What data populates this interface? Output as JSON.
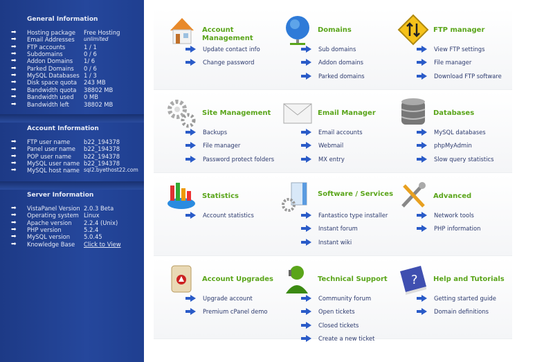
{
  "sidebar": {
    "sections": [
      {
        "title": "General Information",
        "rows": [
          {
            "label": "Hosting package",
            "value": "Free Hosting"
          },
          {
            "label": "Email Addresses",
            "value": "unlimited",
            "style": "italic"
          },
          {
            "label": "FTP accounts",
            "value": "1 / 1"
          },
          {
            "label": "Subdomains",
            "value": "0 / 6"
          },
          {
            "label": "Addon Domains",
            "value": "1/ 6"
          },
          {
            "label": "Parked Domains",
            "value": "0 / 6"
          },
          {
            "label": "MySQL Databases",
            "value": "1 / 3"
          },
          {
            "label": "Disk space quota",
            "value": "243 MB"
          },
          {
            "label": "Bandwidth quota",
            "value": "38802 MB"
          },
          {
            "label": "Bandwidth used",
            "value": "0 MB"
          },
          {
            "label": "Bandwidth left",
            "value": "38802 MB"
          }
        ]
      },
      {
        "title": "Account Information",
        "rows": [
          {
            "label": "FTP user name",
            "value": "b22_194378"
          },
          {
            "label": "Panel user name",
            "value": "b22_194378"
          },
          {
            "label": "POP user name",
            "value": "b22_194378"
          },
          {
            "label": "MySQL user name",
            "value": "b22_194378"
          },
          {
            "label": "MySQL host name",
            "value": "sql2.byethost22.com",
            "style": "small"
          }
        ]
      },
      {
        "title": "Server Information",
        "rows": [
          {
            "label": "VistaPanel Version",
            "value": "2.0.3 Beta"
          },
          {
            "label": "Operating system",
            "value": "Linux"
          },
          {
            "label": "Apache version",
            "value": "2.2.4 (Unix)"
          },
          {
            "label": "PHP version",
            "value": "5.2.4"
          },
          {
            "label": "MySQL version",
            "value": "5.0.45"
          },
          {
            "label": "Knowledge Base",
            "value": "Click to View",
            "style": "link"
          }
        ]
      }
    ]
  },
  "main": {
    "sections": [
      {
        "title": "Account Management",
        "icon": "house-icon",
        "links": [
          "Update contact info",
          "Change password"
        ]
      },
      {
        "title": "Domains",
        "icon": "globe-icon",
        "links": [
          "Sub domains",
          "Addon domains",
          "Parked domains"
        ]
      },
      {
        "title": "FTP manager",
        "icon": "ftp-sign-icon",
        "links": [
          "View FTP settings",
          "File manager",
          "Download FTP software"
        ]
      },
      {
        "title": "Site Management",
        "icon": "gears-icon",
        "links": [
          "Backups",
          "File manager",
          "Password protect folders"
        ]
      },
      {
        "title": "Email Manager",
        "icon": "envelope-icon",
        "links": [
          "Email accounts",
          "Webmail",
          "MX entry"
        ]
      },
      {
        "title": "Databases",
        "icon": "database-icon",
        "links": [
          "MySQL databases",
          "phpMyAdmin",
          "Slow query statistics"
        ]
      },
      {
        "title": "Statistics",
        "icon": "chart-icon",
        "links": [
          "Account statistics"
        ]
      },
      {
        "title": "Software / Services",
        "icon": "software-box-icon",
        "links": [
          "Fantastico type installer",
          "Instant forum",
          "Instant wiki"
        ]
      },
      {
        "title": "Advanced",
        "icon": "tools-icon",
        "links": [
          "Network tools",
          "PHP information"
        ]
      },
      {
        "title": "Account Upgrades",
        "icon": "upgrade-scroll-icon",
        "links": [
          "Upgrade account",
          "Premium cPanel demo"
        ]
      },
      {
        "title": "Technical Support",
        "icon": "support-person-icon",
        "links": [
          "Community forum",
          "Open tickets",
          "Closed tickets",
          "Create a new ticket"
        ]
      },
      {
        "title": "Help and Tutorials",
        "icon": "help-book-icon",
        "links": [
          "Getting started guide",
          "Domain definitions"
        ]
      }
    ]
  },
  "colors": {
    "heading": "#5aa51a",
    "link": "#2c3a6e",
    "sidebar": "#25479c",
    "arrow": "#2a5bc8"
  }
}
